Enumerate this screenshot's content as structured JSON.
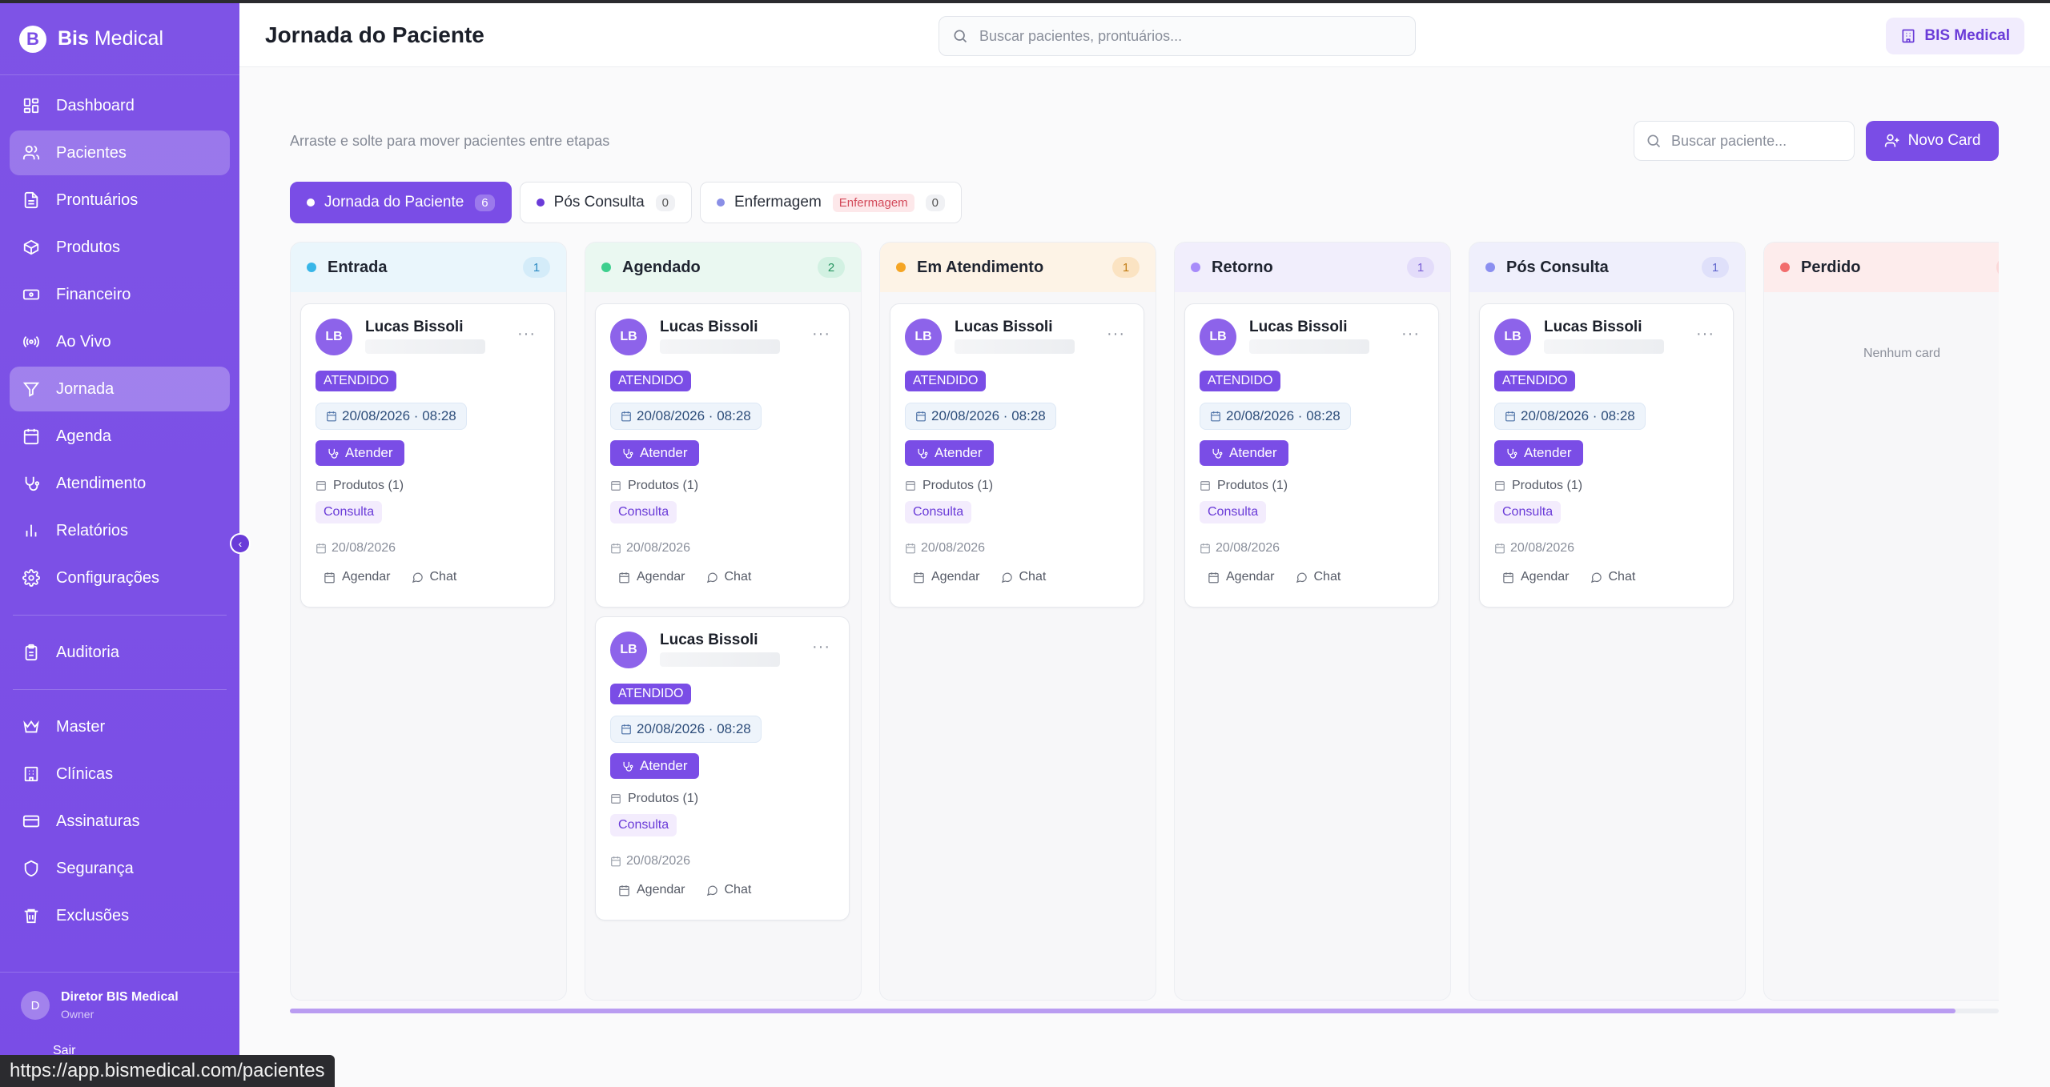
{
  "brand": {
    "logo_letter": "B",
    "name_bold": "Bis",
    "name_rest": " Medical"
  },
  "sidebar": {
    "items": [
      {
        "label": "Dashboard",
        "icon": "grid-icon"
      },
      {
        "label": "Pacientes",
        "icon": "users-icon"
      },
      {
        "label": "Prontuários",
        "icon": "file-icon"
      },
      {
        "label": "Produtos",
        "icon": "box-icon"
      },
      {
        "label": "Financeiro",
        "icon": "banknote-icon"
      },
      {
        "label": "Ao Vivo",
        "icon": "broadcast-icon"
      },
      {
        "label": "Jornada",
        "icon": "funnel-icon"
      },
      {
        "label": "Agenda",
        "icon": "calendar-icon"
      },
      {
        "label": "Atendimento",
        "icon": "stethoscope-icon"
      },
      {
        "label": "Relatórios",
        "icon": "bar-chart-icon"
      },
      {
        "label": "Configurações",
        "icon": "gear-icon"
      }
    ],
    "audit": {
      "label": "Auditoria",
      "icon": "clipboard-icon"
    },
    "admin_items": [
      {
        "label": "Master",
        "icon": "crown-icon"
      },
      {
        "label": "Clínicas",
        "icon": "building-icon"
      },
      {
        "label": "Assinaturas",
        "icon": "credit-card-icon"
      },
      {
        "label": "Segurança",
        "icon": "shield-icon"
      },
      {
        "label": "Exclusões",
        "icon": "trash-icon"
      }
    ],
    "collapse_glyph": "‹",
    "user": {
      "initial": "D",
      "name": "Diretor BIS Medical",
      "role": "Owner"
    },
    "logout_label": "Sair"
  },
  "header": {
    "title": "Jornada do Paciente",
    "search_placeholder": "Buscar pacientes, prontuários...",
    "clinic_label": "BIS Medical"
  },
  "main": {
    "subtitle": "Arraste e solte para mover pacientes entre etapas",
    "search_placeholder": "Buscar paciente...",
    "new_card_label": "Novo Card",
    "tabs": [
      {
        "label": "Jornada do Paciente",
        "count": "6",
        "dot_color": "#ffffff"
      },
      {
        "label": "Pós Consulta",
        "count": "0",
        "dot_color": "#6a3bd8"
      },
      {
        "label": "Enfermagem",
        "tag": "Enfermagem",
        "count": "0",
        "dot_color": "#8a8fe6"
      }
    ]
  },
  "board": {
    "columns": [
      {
        "title": "Entrada",
        "count": "1",
        "dot_color": "#38b6e8",
        "head_bg": "#eaf6fc",
        "count_bg": "#d4ecf9",
        "count_color": "#2b8ac2"
      },
      {
        "title": "Agendado",
        "count": "2",
        "dot_color": "#3ecf8e",
        "head_bg": "#eaf8f1",
        "count_bg": "#d2f1e2",
        "count_color": "#24935f"
      },
      {
        "title": "Em Atendimento",
        "count": "1",
        "dot_color": "#f5a524",
        "head_bg": "#fdf3e6",
        "count_bg": "#fbe3c2",
        "count_color": "#c07a10"
      },
      {
        "title": "Retorno",
        "count": "1",
        "dot_color": "#a78bfa",
        "head_bg": "#f1eefc",
        "count_bg": "#e3dcfa",
        "count_color": "#7a5fd6"
      },
      {
        "title": "Pós Consulta",
        "count": "1",
        "dot_color": "#8b8ff0",
        "head_bg": "#efeffc",
        "count_bg": "#dfe0fa",
        "count_color": "#5e63cc"
      },
      {
        "title": "Perdido",
        "count": "",
        "dot_color": "#f26d6d",
        "head_bg": "#fdecec",
        "count_bg": "#fbd8d8",
        "count_color": "#c94a4a",
        "empty_text": "Nenhum card"
      }
    ],
    "card": {
      "initials": "LB",
      "name": "Lucas Bissoli",
      "more": "···",
      "status": "ATENDIDO",
      "datetime": "20/08/2026 · 08:28",
      "action": "Atender",
      "produtos": "Produtos (1)",
      "tag": "Consulta",
      "date": "20/08/2026",
      "schedule_label": "Agendar",
      "chat_label": "Chat"
    }
  },
  "status_bar_url": "https://app.bismedical.com/pacientes"
}
